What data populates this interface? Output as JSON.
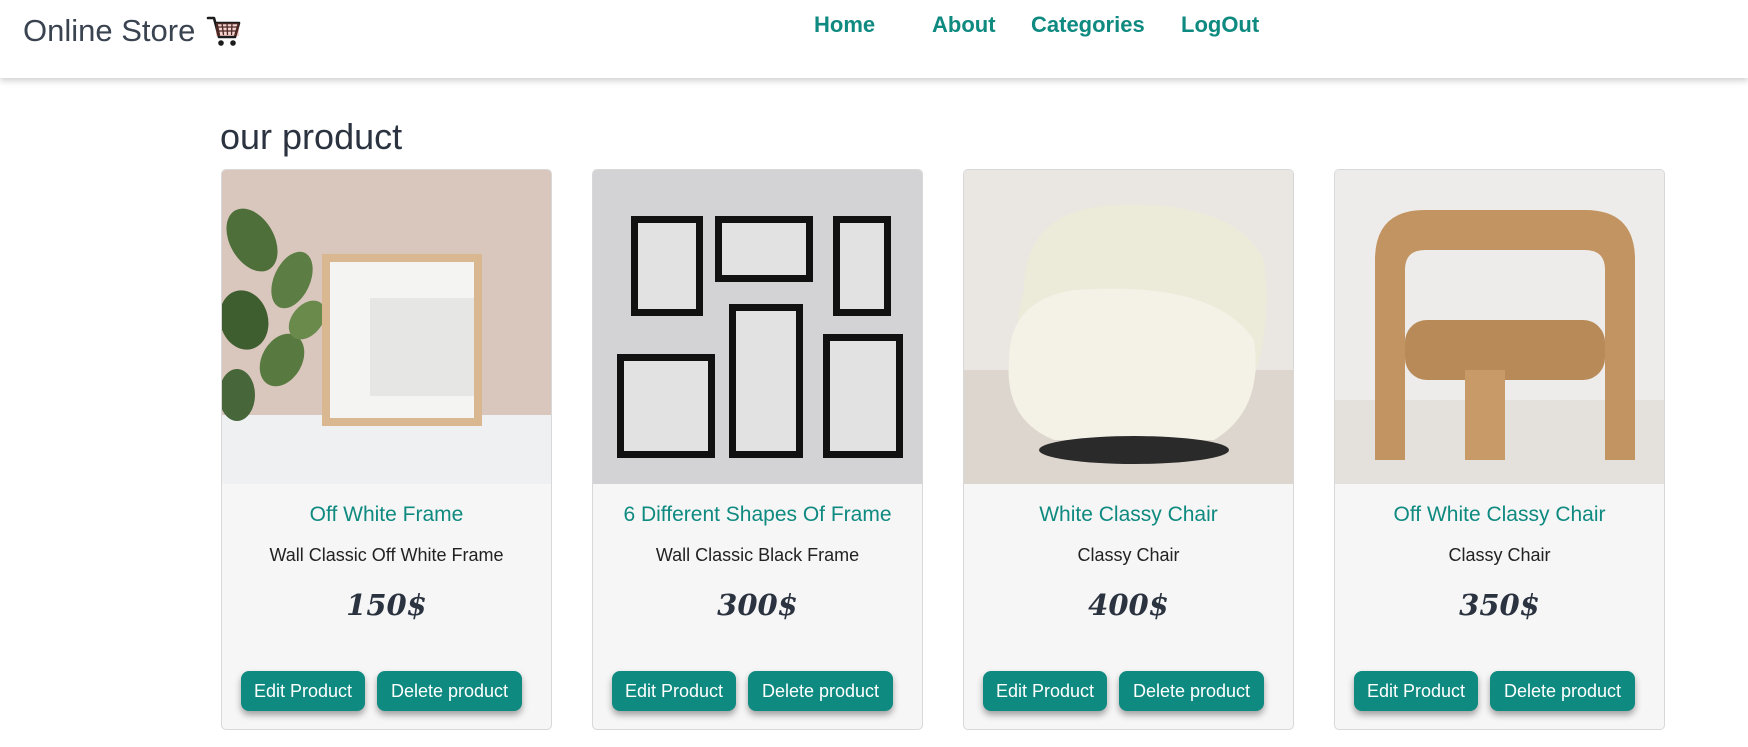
{
  "brand": {
    "title": "Online Store",
    "icon": "shopping-cart-icon"
  },
  "nav": {
    "items": [
      {
        "label": "Home"
      },
      {
        "label": "About"
      },
      {
        "label": "Categories"
      },
      {
        "label": "LogOut"
      }
    ]
  },
  "main": {
    "title": "our product",
    "products": [
      {
        "name": "Off White Frame",
        "description": "Wall Classic Off White Frame",
        "price": "150$",
        "edit_label": "Edit Product",
        "delete_label": "Delete product"
      },
      {
        "name": "6 Different Shapes Of Frame",
        "description": "Wall Classic Black Frame",
        "price": "300$",
        "edit_label": "Edit Product",
        "delete_label": "Delete product"
      },
      {
        "name": "White Classy Chair",
        "description": "Classy Chair",
        "price": "400$",
        "edit_label": "Edit Product",
        "delete_label": "Delete product"
      },
      {
        "name": "Off White Classy Chair",
        "description": "Classy Chair",
        "price": "350$",
        "edit_label": "Edit Product",
        "delete_label": "Delete product"
      }
    ]
  },
  "colors": {
    "accent": "#0f8a80",
    "text": "#2b3340",
    "card_bg": "#f6f6f6"
  }
}
